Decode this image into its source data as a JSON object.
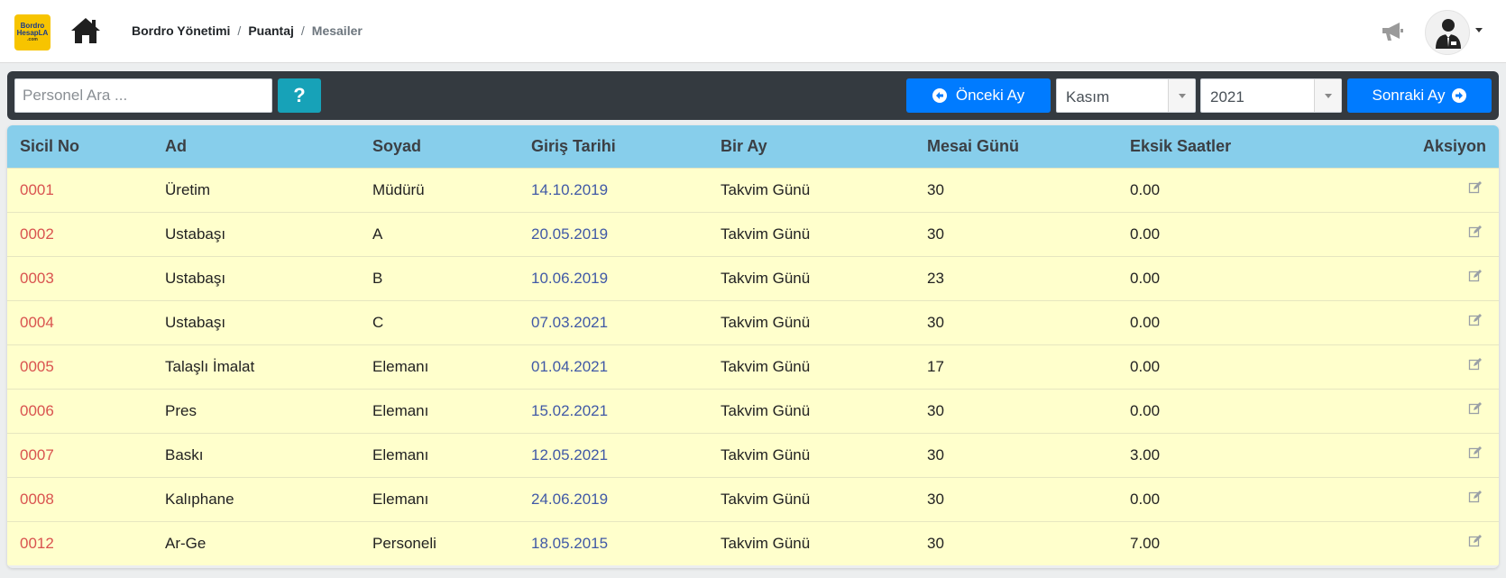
{
  "header": {
    "logo": {
      "line1": "Bordro",
      "line2": "HesapLA",
      "line3": ".com"
    },
    "breadcrumb": [
      "Bordro Yönetimi",
      "Puantaj",
      "Mesailer"
    ]
  },
  "toolbar": {
    "search_placeholder": "Personel Ara ...",
    "help_label": "?",
    "prev_label": "Önceki Ay",
    "month_value": "Kasım",
    "year_value": "2021",
    "next_label": "Sonraki Ay"
  },
  "table": {
    "columns": [
      "Sicil No",
      "Ad",
      "Soyad",
      "Giriş Tarihi",
      "Bir Ay",
      "Mesai Günü",
      "Eksik Saatler",
      "Aksiyon"
    ],
    "rows": [
      {
        "sicil": "0001",
        "ad": "Üretim",
        "soyad": "Müdürü",
        "giris": "14.10.2019",
        "bir_ay": "Takvim Günü",
        "mesai": "30",
        "eksik": "0.00"
      },
      {
        "sicil": "0002",
        "ad": "Ustabaşı",
        "soyad": "A",
        "giris": "20.05.2019",
        "bir_ay": "Takvim Günü",
        "mesai": "30",
        "eksik": "0.00"
      },
      {
        "sicil": "0003",
        "ad": "Ustabaşı",
        "soyad": "B",
        "giris": "10.06.2019",
        "bir_ay": "Takvim Günü",
        "mesai": "23",
        "eksik": "0.00"
      },
      {
        "sicil": "0004",
        "ad": "Ustabaşı",
        "soyad": "C",
        "giris": "07.03.2021",
        "bir_ay": "Takvim Günü",
        "mesai": "30",
        "eksik": "0.00"
      },
      {
        "sicil": "0005",
        "ad": "Talaşlı İmalat",
        "soyad": "Elemanı",
        "giris": "01.04.2021",
        "bir_ay": "Takvim Günü",
        "mesai": "17",
        "eksik": "0.00"
      },
      {
        "sicil": "0006",
        "ad": "Pres",
        "soyad": "Elemanı",
        "giris": "15.02.2021",
        "bir_ay": "Takvim Günü",
        "mesai": "30",
        "eksik": "0.00"
      },
      {
        "sicil": "0007",
        "ad": "Baskı",
        "soyad": "Elemanı",
        "giris": "12.05.2021",
        "bir_ay": "Takvim Günü",
        "mesai": "30",
        "eksik": "3.00"
      },
      {
        "sicil": "0008",
        "ad": "Kalıphane",
        "soyad": "Elemanı",
        "giris": "24.06.2019",
        "bir_ay": "Takvim Günü",
        "mesai": "30",
        "eksik": "0.00"
      },
      {
        "sicil": "0012",
        "ad": "Ar-Ge",
        "soyad": "Personeli",
        "giris": "18.05.2015",
        "bir_ay": "Takvim Günü",
        "mesai": "30",
        "eksik": "7.00"
      }
    ]
  },
  "colors": {
    "header_bg": "#87ceeb",
    "row_bg": "#ffffcc",
    "toolbar_bg": "#343a40",
    "primary": "#007bff",
    "info": "#17a2b8",
    "sicil_text": "#d9534f",
    "date_text": "#4059a6"
  },
  "icons": [
    "home-icon",
    "megaphone-icon",
    "user-avatar-icon",
    "arrow-left-circle-icon",
    "arrow-right-circle-icon",
    "edit-icon"
  ]
}
